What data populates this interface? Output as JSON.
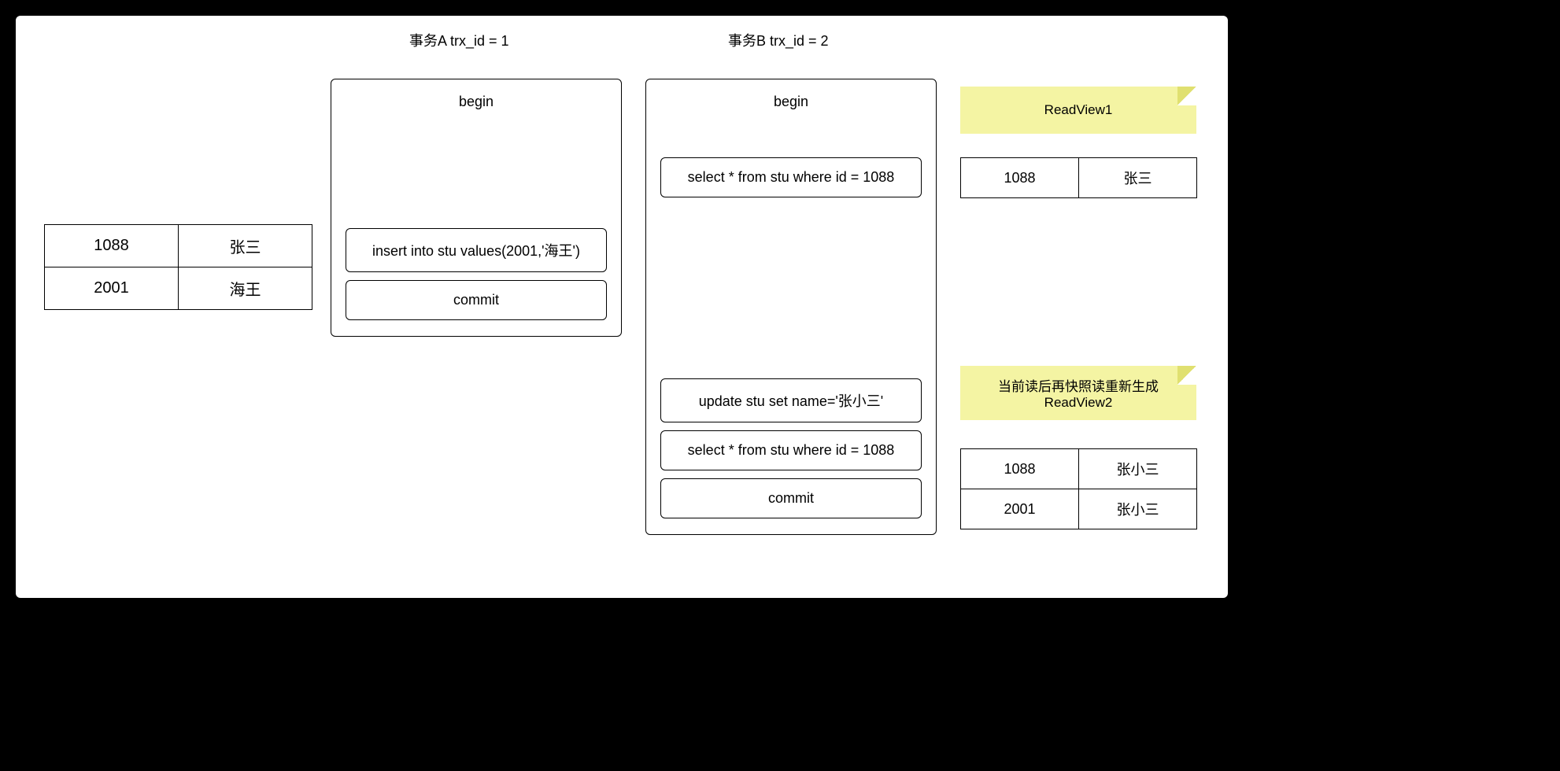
{
  "headers": {
    "txA": "事务A trx_id = 1",
    "txB": "事务B trx_id = 2"
  },
  "txA": {
    "begin": "begin",
    "insert": "insert into stu values(2001,'海王')",
    "commit": "commit"
  },
  "txB": {
    "begin": "begin",
    "select1": "select * from stu where id = 1088",
    "update": "update stu set name='张小三'",
    "select2": "select * from stu where id = 1088",
    "commit": "commit"
  },
  "leftTable": {
    "rows": [
      {
        "id": "1088",
        "name": "张三"
      },
      {
        "id": "2001",
        "name": "海王"
      }
    ]
  },
  "note1": {
    "text": "ReadView1"
  },
  "readView1Table": {
    "rows": [
      {
        "id": "1088",
        "name": "张三"
      }
    ]
  },
  "note2": {
    "line1": "当前读后再快照读重新生成",
    "line2": "ReadView2"
  },
  "readView2Table": {
    "rows": [
      {
        "id": "1088",
        "name": "张小三"
      },
      {
        "id": "2001",
        "name": "张小三"
      }
    ]
  }
}
